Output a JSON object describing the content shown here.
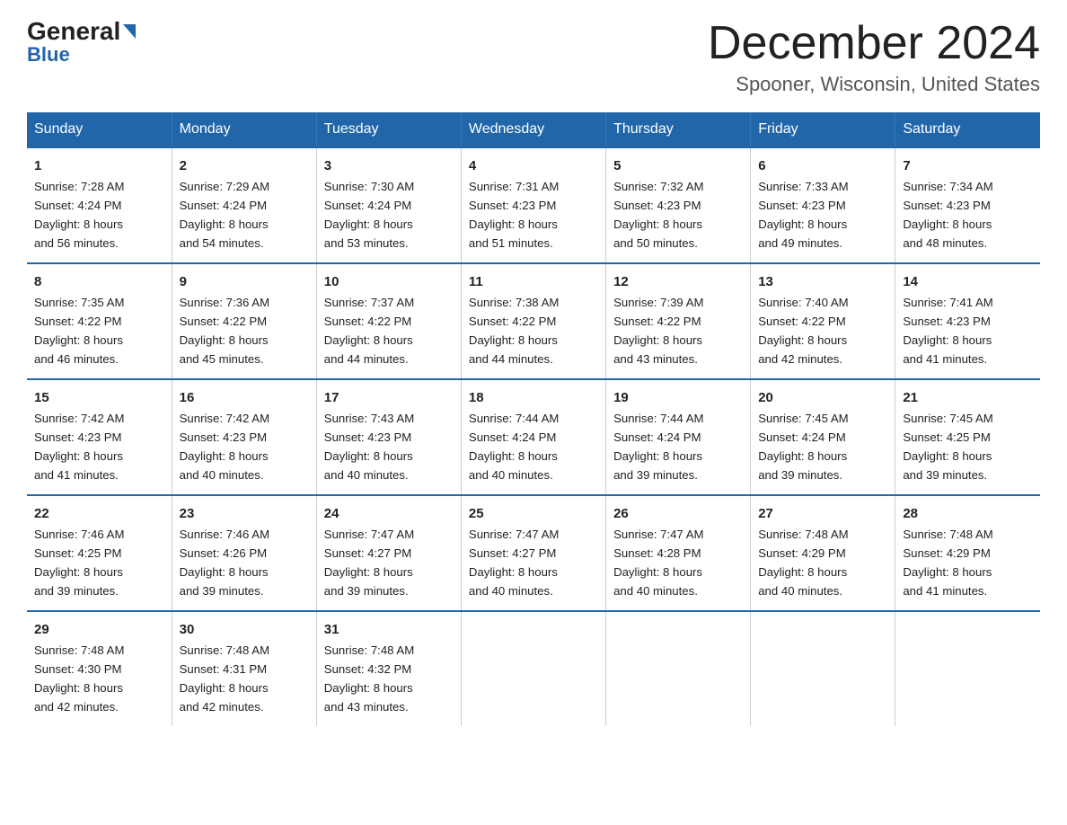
{
  "logo": {
    "top": "General",
    "bottom": "Blue"
  },
  "title": "December 2024",
  "subtitle": "Spooner, Wisconsin, United States",
  "days_of_week": [
    "Sunday",
    "Monday",
    "Tuesday",
    "Wednesday",
    "Thursday",
    "Friday",
    "Saturday"
  ],
  "weeks": [
    [
      {
        "day": "1",
        "sunrise": "7:28 AM",
        "sunset": "4:24 PM",
        "daylight": "8 hours and 56 minutes."
      },
      {
        "day": "2",
        "sunrise": "7:29 AM",
        "sunset": "4:24 PM",
        "daylight": "8 hours and 54 minutes."
      },
      {
        "day": "3",
        "sunrise": "7:30 AM",
        "sunset": "4:24 PM",
        "daylight": "8 hours and 53 minutes."
      },
      {
        "day": "4",
        "sunrise": "7:31 AM",
        "sunset": "4:23 PM",
        "daylight": "8 hours and 51 minutes."
      },
      {
        "day": "5",
        "sunrise": "7:32 AM",
        "sunset": "4:23 PM",
        "daylight": "8 hours and 50 minutes."
      },
      {
        "day": "6",
        "sunrise": "7:33 AM",
        "sunset": "4:23 PM",
        "daylight": "8 hours and 49 minutes."
      },
      {
        "day": "7",
        "sunrise": "7:34 AM",
        "sunset": "4:23 PM",
        "daylight": "8 hours and 48 minutes."
      }
    ],
    [
      {
        "day": "8",
        "sunrise": "7:35 AM",
        "sunset": "4:22 PM",
        "daylight": "8 hours and 46 minutes."
      },
      {
        "day": "9",
        "sunrise": "7:36 AM",
        "sunset": "4:22 PM",
        "daylight": "8 hours and 45 minutes."
      },
      {
        "day": "10",
        "sunrise": "7:37 AM",
        "sunset": "4:22 PM",
        "daylight": "8 hours and 44 minutes."
      },
      {
        "day": "11",
        "sunrise": "7:38 AM",
        "sunset": "4:22 PM",
        "daylight": "8 hours and 44 minutes."
      },
      {
        "day": "12",
        "sunrise": "7:39 AM",
        "sunset": "4:22 PM",
        "daylight": "8 hours and 43 minutes."
      },
      {
        "day": "13",
        "sunrise": "7:40 AM",
        "sunset": "4:22 PM",
        "daylight": "8 hours and 42 minutes."
      },
      {
        "day": "14",
        "sunrise": "7:41 AM",
        "sunset": "4:23 PM",
        "daylight": "8 hours and 41 minutes."
      }
    ],
    [
      {
        "day": "15",
        "sunrise": "7:42 AM",
        "sunset": "4:23 PM",
        "daylight": "8 hours and 41 minutes."
      },
      {
        "day": "16",
        "sunrise": "7:42 AM",
        "sunset": "4:23 PM",
        "daylight": "8 hours and 40 minutes."
      },
      {
        "day": "17",
        "sunrise": "7:43 AM",
        "sunset": "4:23 PM",
        "daylight": "8 hours and 40 minutes."
      },
      {
        "day": "18",
        "sunrise": "7:44 AM",
        "sunset": "4:24 PM",
        "daylight": "8 hours and 40 minutes."
      },
      {
        "day": "19",
        "sunrise": "7:44 AM",
        "sunset": "4:24 PM",
        "daylight": "8 hours and 39 minutes."
      },
      {
        "day": "20",
        "sunrise": "7:45 AM",
        "sunset": "4:24 PM",
        "daylight": "8 hours and 39 minutes."
      },
      {
        "day": "21",
        "sunrise": "7:45 AM",
        "sunset": "4:25 PM",
        "daylight": "8 hours and 39 minutes."
      }
    ],
    [
      {
        "day": "22",
        "sunrise": "7:46 AM",
        "sunset": "4:25 PM",
        "daylight": "8 hours and 39 minutes."
      },
      {
        "day": "23",
        "sunrise": "7:46 AM",
        "sunset": "4:26 PM",
        "daylight": "8 hours and 39 minutes."
      },
      {
        "day": "24",
        "sunrise": "7:47 AM",
        "sunset": "4:27 PM",
        "daylight": "8 hours and 39 minutes."
      },
      {
        "day": "25",
        "sunrise": "7:47 AM",
        "sunset": "4:27 PM",
        "daylight": "8 hours and 40 minutes."
      },
      {
        "day": "26",
        "sunrise": "7:47 AM",
        "sunset": "4:28 PM",
        "daylight": "8 hours and 40 minutes."
      },
      {
        "day": "27",
        "sunrise": "7:48 AM",
        "sunset": "4:29 PM",
        "daylight": "8 hours and 40 minutes."
      },
      {
        "day": "28",
        "sunrise": "7:48 AM",
        "sunset": "4:29 PM",
        "daylight": "8 hours and 41 minutes."
      }
    ],
    [
      {
        "day": "29",
        "sunrise": "7:48 AM",
        "sunset": "4:30 PM",
        "daylight": "8 hours and 42 minutes."
      },
      {
        "day": "30",
        "sunrise": "7:48 AM",
        "sunset": "4:31 PM",
        "daylight": "8 hours and 42 minutes."
      },
      {
        "day": "31",
        "sunrise": "7:48 AM",
        "sunset": "4:32 PM",
        "daylight": "8 hours and 43 minutes."
      },
      {
        "day": "",
        "sunrise": "",
        "sunset": "",
        "daylight": ""
      },
      {
        "day": "",
        "sunrise": "",
        "sunset": "",
        "daylight": ""
      },
      {
        "day": "",
        "sunrise": "",
        "sunset": "",
        "daylight": ""
      },
      {
        "day": "",
        "sunrise": "",
        "sunset": "",
        "daylight": ""
      }
    ]
  ],
  "labels": {
    "sunrise": "Sunrise:",
    "sunset": "Sunset:",
    "daylight": "Daylight:"
  }
}
